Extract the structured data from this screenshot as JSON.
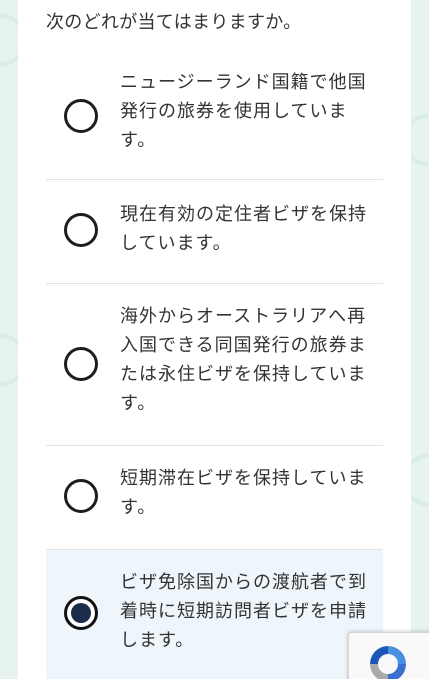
{
  "question": "次のどれが当てはまりますか。",
  "options": [
    {
      "label": "ニュージーランド国籍で他国発行の旅券を使用しています。",
      "selected": false
    },
    {
      "label": "現在有効の定住者ビザを保持しています。",
      "selected": false
    },
    {
      "label": "海外からオーストラリアへ再入国できる同国発行の旅券または永住ビザを保持しています。",
      "selected": false
    },
    {
      "label": "短期滞在ビザを保持しています。",
      "selected": false
    },
    {
      "label": "ビザ免除国からの渡航者で到着時に短期訪問者ビザを申請します。",
      "selected": true
    }
  ],
  "recaptcha": {
    "icon": "recaptcha-icon"
  }
}
